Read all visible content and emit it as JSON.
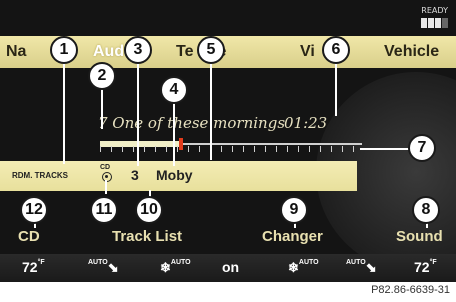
{
  "status": {
    "ready": "READY"
  },
  "menu": {
    "items": [
      {
        "label": "Navi",
        "visible_part": "Na",
        "active": false
      },
      {
        "label": "Audio",
        "visible_part": "Aud",
        "active": true
      },
      {
        "label": "Telephone",
        "visible_part": "Te    one",
        "active": false
      },
      {
        "label": "Video",
        "visible_part": "Vi",
        "active": false
      },
      {
        "label": "Vehicle",
        "visible_part": "Vehicle",
        "active": false
      }
    ]
  },
  "player": {
    "track_title": "7 One of these mornings",
    "elapsed": "01:23",
    "progress": 0.3,
    "mode": "RDM. TRACKS",
    "source_label": "CD",
    "track_number": "3",
    "artist": "Moby"
  },
  "softkeys": [
    "CD",
    "Track List",
    "Changer",
    "Sound"
  ],
  "climate": {
    "left_temp": "72",
    "left_unit": "°F",
    "auto_left": "AUTO",
    "fan_left": "AUTO",
    "center": "on",
    "fan_right": "AUTO",
    "auto_right": "AUTO",
    "right_temp": "72",
    "right_unit": "°F"
  },
  "callouts": [
    "1",
    "2",
    "3",
    "4",
    "5",
    "6",
    "7",
    "8",
    "9",
    "10",
    "11",
    "12"
  ],
  "caption": "P82.86-6639-31",
  "colors": {
    "menu_bg": "#e8df9e",
    "info_bg": "#efe7aa",
    "screen_bg": "#141414",
    "progress_marker": "#e23b1b"
  }
}
